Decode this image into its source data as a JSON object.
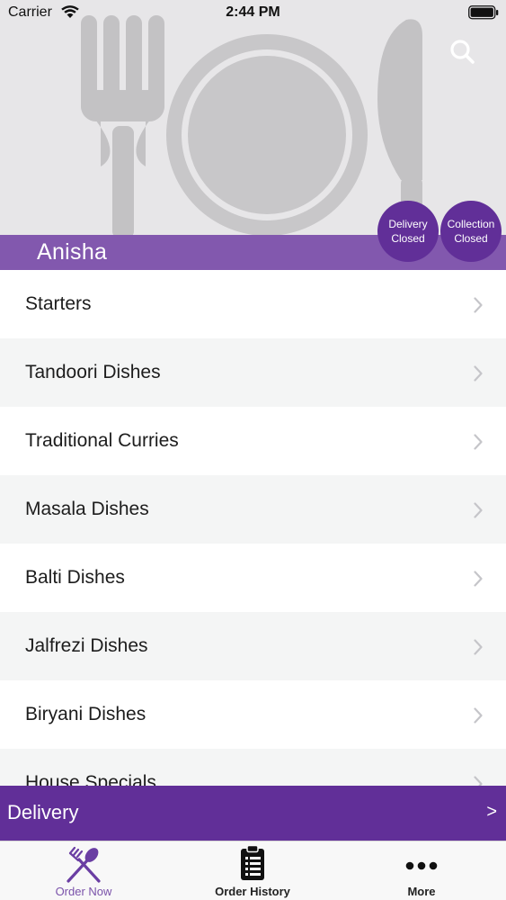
{
  "status_bar": {
    "carrier": "Carrier",
    "time": "2:44 PM",
    "wifi_icon": "wifi-icon",
    "battery_icon": "battery-icon"
  },
  "header": {
    "restaurant_name": "Anisha",
    "background_icon": "plate-cutlery-icon",
    "search_icon": "search-icon",
    "badges": {
      "delivery": {
        "line1": "Delivery",
        "line2": "Closed"
      },
      "collection": {
        "line1": "Collection",
        "line2": "Closed"
      }
    }
  },
  "menu": {
    "categories": [
      {
        "label": "Starters"
      },
      {
        "label": "Tandoori Dishes"
      },
      {
        "label": "Traditional Curries"
      },
      {
        "label": "Masala Dishes"
      },
      {
        "label": "Balti Dishes"
      },
      {
        "label": "Jalfrezi Dishes"
      },
      {
        "label": "Biryani Dishes"
      },
      {
        "label": "House Specials"
      }
    ],
    "chevron_icon": "chevron-right-icon"
  },
  "delivery_bar": {
    "label": "Delivery",
    "arrow": ">"
  },
  "tab_bar": {
    "tabs": [
      {
        "label": "Order Now",
        "icon": "fork-spoon-icon",
        "active": true
      },
      {
        "label": "Order History",
        "icon": "clipboard-list-icon",
        "active": false
      },
      {
        "label": "More",
        "icon": "more-dots-icon",
        "active": false
      }
    ]
  },
  "colors": {
    "primary_purple": "#612f98",
    "band_purple": "#8258ae",
    "tab_active": "#7a52aa",
    "hero_background": "#e7e6e8",
    "row_alt": "#f4f5f5"
  }
}
